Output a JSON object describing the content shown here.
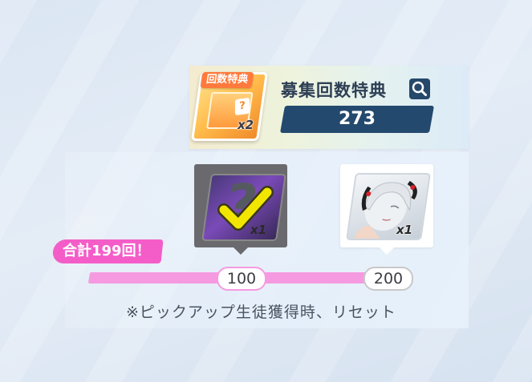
{
  "header": {
    "bonus_tag": "回数特典",
    "bonus_count": "x2",
    "title": "募集回数特典",
    "recruit_count": "273"
  },
  "rewards": [
    {
      "count": "x1",
      "state": "claimed",
      "milestone": "100"
    },
    {
      "count": "x1",
      "state": "pending",
      "milestone": "200"
    }
  ],
  "progress": {
    "total_label": "合計199回！",
    "notice": "※ピックアップ生徒獲得時、リセット"
  },
  "colors": {
    "accent_pink": "#f45dc8",
    "bar_pink": "#f59ae0",
    "navy": "#24496e",
    "check_yellow": "#f2e600"
  },
  "icons": [
    "search-icon",
    "check-icon",
    "question-mark-icon"
  ]
}
